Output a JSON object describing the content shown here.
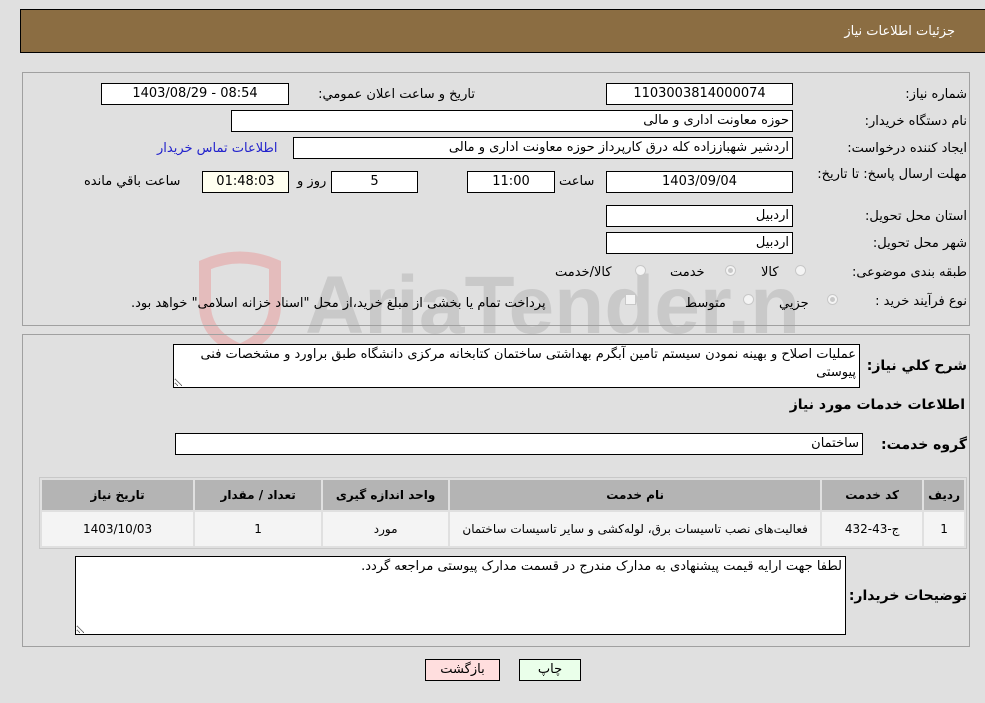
{
  "header": {
    "title": "جزئیات اطلاعات نیاز"
  },
  "form": {
    "need_number": {
      "label": "شماره نیاز:",
      "value": "1103003814000074"
    },
    "announce_datetime": {
      "label": "تاریخ و ساعت اعلان عمومي:",
      "value": "1403/08/29 - 08:54"
    },
    "buyer_org": {
      "label": "نام دستگاه خريدار:",
      "value": "حوزه معاونت اداری و مالی"
    },
    "requester": {
      "label": "ایجاد کننده درخواست:",
      "value": "اردشیر شهباززاده کله درق کارپرداز حوزه معاونت اداری و مالی"
    },
    "buyer_contact_link": "اطلاعات تماس خریدار",
    "deadline": {
      "label": "مهلت ارسال پاسخ: تا تاریخ:",
      "date": "1403/09/04",
      "time_label": "ساعت",
      "time": "11:00",
      "days": "5",
      "days_label": "روز و",
      "remaining": "01:48:03",
      "remaining_label": "ساعت باقي مانده"
    },
    "delivery_province": {
      "label": "استان محل تحویل:",
      "value": "اردبیل"
    },
    "delivery_city": {
      "label": "شهر محل تحویل:",
      "value": "اردبیل"
    },
    "category": {
      "label": "طبقه بندی موضوعی:",
      "options": [
        "کالا",
        "خدمت",
        "کالا/خدمت"
      ],
      "selected": "خدمت"
    },
    "purchase_type": {
      "label": "نوع فرآیند خرید :",
      "options": [
        "جزيي",
        "متوسط"
      ],
      "selected": "جزيي",
      "treasury_checkbox_label": "پرداخت تمام یا بخشی از مبلغ خرید،از محل \"اسناد خزانه اسلامی\" خواهد بود.",
      "treasury_checked": false
    }
  },
  "description": {
    "label": "شرح كلي نياز:",
    "value": "عملیات اصلاح و بهینه نمودن سیستم تامین آبگرم بهداشتی ساختمان کتابخانه مرکزی دانشگاه طبق براورد و مشخصات فنی پیوستی"
  },
  "services_section": {
    "title": "اطلاعات خدمات مورد نیاز",
    "service_group": {
      "label": "گروه خدمت:",
      "value": "ساختمان"
    },
    "table": {
      "headers": [
        "ردیف",
        "کد خدمت",
        "نام خدمت",
        "واحد اندازه گیری",
        "تعداد / مقدار",
        "تاریخ نیاز"
      ],
      "rows": [
        [
          "1",
          "ج-43-432",
          "فعالیت‌های نصب تاسیسات برق، لوله‌کشی و سایر تاسیسات ساختمان",
          "مورد",
          "1",
          "1403/10/03"
        ]
      ]
    }
  },
  "buyer_notes": {
    "label": "توضیحات خریدار:",
    "value": "لطفا جهت ارایه قیمت پیشنهادی به مدارک مندرج در قسمت مدارک پیوستی مراجعه گردد."
  },
  "buttons": {
    "print": "چاپ",
    "back": "بازگشت"
  },
  "watermark": {
    "text": "AriaTender.neT"
  },
  "colors": {
    "header_bg": "#8b6d42",
    "print_bg": "#eaffea",
    "back_bg": "#ffdede",
    "link": "#2222cc"
  }
}
